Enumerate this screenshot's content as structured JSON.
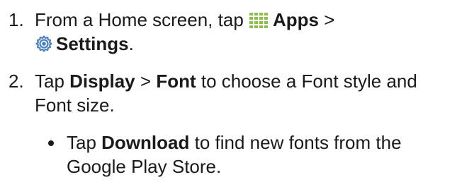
{
  "steps": [
    {
      "number": "1.",
      "line1_prefix": "From a Home screen, tap",
      "apps_label": "Apps",
      "separator": ">",
      "settings_label": "Settings",
      "period": "."
    },
    {
      "number": "2.",
      "prefix": "Tap",
      "display_label": "Display",
      "separator": ">",
      "font_label": "Font",
      "line1_suffix": "to choose a Font style and",
      "line2": "Font size."
    }
  ],
  "bullets": [
    {
      "prefix": "Tap",
      "download_label": "Download",
      "line1_suffix": "to find new fonts from the",
      "line2": "Google Play Store."
    }
  ],
  "icons": {
    "apps": "apps-grid-icon",
    "settings": "settings-gear-icon"
  },
  "colors": {
    "text": "#1a1a1a",
    "apps_icon": "#8bc34a",
    "settings_icon": "#4a7fc1"
  }
}
